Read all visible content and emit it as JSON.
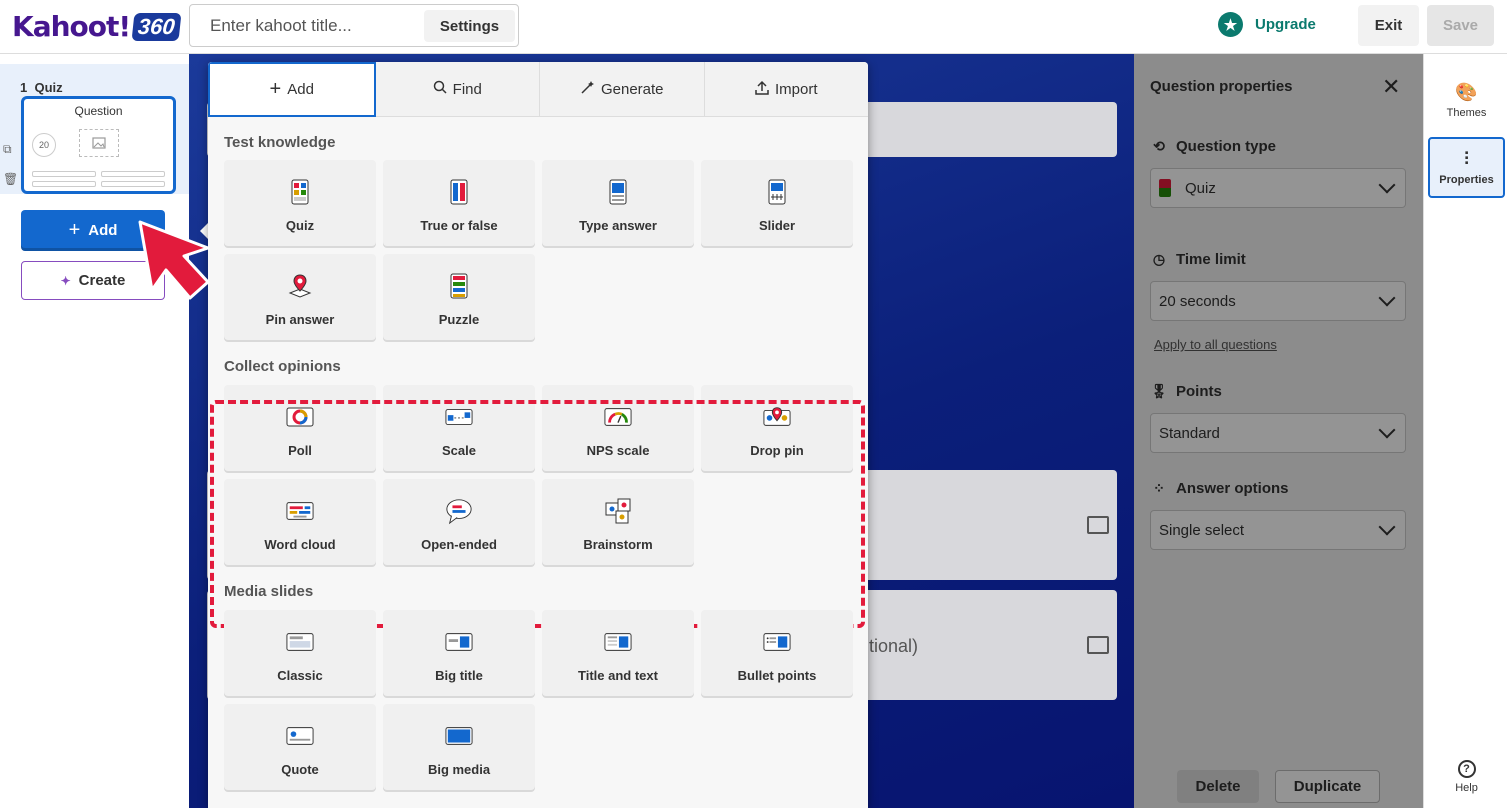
{
  "header": {
    "logo_text": "Kahoot!",
    "logo_badge": "360",
    "title_placeholder": "Enter kahoot title...",
    "settings_label": "Settings",
    "upgrade_label": "Upgrade",
    "exit_label": "Exit",
    "save_label": "Save"
  },
  "sidebar": {
    "slide_label": "1  Quiz",
    "thumb_title": "Question",
    "thumb_timer": "20",
    "add_label": "Add",
    "create_label": "Create"
  },
  "canvas": {
    "optional_text": "tional)"
  },
  "properties": {
    "title": "Question properties",
    "question_type_label": "Question type",
    "question_type_value": "Quiz",
    "time_limit_label": "Time limit",
    "time_limit_value": "20 seconds",
    "apply_all_label": "Apply to all questions",
    "points_label": "Points",
    "points_value": "Standard",
    "answer_options_label": "Answer options",
    "answer_options_value": "Single select",
    "delete_label": "Delete",
    "duplicate_label": "Duplicate"
  },
  "rail": {
    "themes_label": "Themes",
    "properties_label": "Properties",
    "help_label": "Help"
  },
  "popup": {
    "tabs": [
      {
        "label": "Add",
        "icon": "plus-icon"
      },
      {
        "label": "Find",
        "icon": "search-icon"
      },
      {
        "label": "Generate",
        "icon": "magic-wand-icon"
      },
      {
        "label": "Import",
        "icon": "upload-icon"
      }
    ],
    "sections": [
      {
        "title": "Test knowledge",
        "items": [
          "Quiz",
          "True or false",
          "Type answer",
          "Slider",
          "Pin answer",
          "Puzzle"
        ]
      },
      {
        "title": "Collect opinions",
        "items": [
          "Poll",
          "Scale",
          "NPS scale",
          "Drop pin",
          "Word cloud",
          "Open-ended",
          "Brainstorm"
        ]
      },
      {
        "title": "Media slides",
        "items": [
          "Classic",
          "Big title",
          "Title and text",
          "Bullet points",
          "Quote",
          "Big media"
        ]
      }
    ]
  },
  "colors": {
    "brand_purple": "#46178f",
    "primary_blue": "#1368ce",
    "upgrade_green": "#0b7a6e",
    "highlight_red": "#e21b3c"
  }
}
